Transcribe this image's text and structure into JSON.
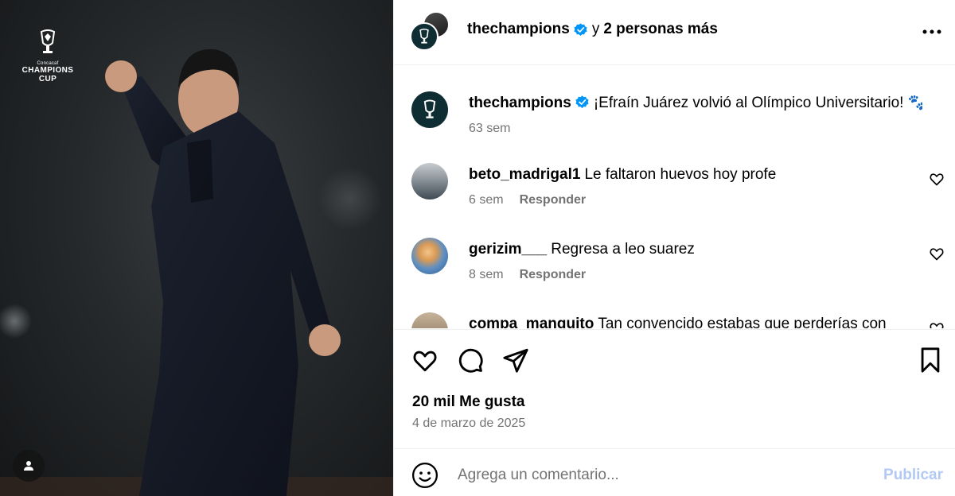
{
  "media": {
    "logo_small": "Concacaf",
    "logo_line1": "CHAMPIONS",
    "logo_line2": "CUP",
    "tag_icon": "user-icon"
  },
  "header": {
    "username": "thechampions",
    "verified": true,
    "connector": "y",
    "collaborators": "2 personas más",
    "more_icon": "more-options-icon"
  },
  "caption": {
    "username": "thechampions",
    "text": "¡Efraín Juárez volvió al Olímpico Universitario! 🐾",
    "time": "63 sem"
  },
  "comments": [
    {
      "username": "beto_madrigal1",
      "text": "Le faltaron huevos hoy profe",
      "time": "6 sem",
      "reply": "Responder"
    },
    {
      "username": "gerizim___",
      "text": "Regresa a leo suarez",
      "time": "8 sem",
      "reply": "Responder"
    },
    {
      "username": "compa_manguito",
      "text": "Tan convencido estabas que perderías con",
      "time": "",
      "reply": ""
    }
  ],
  "actions": {
    "likes": "20 mil Me gusta",
    "date": "4 de marzo de 2025"
  },
  "composer": {
    "placeholder": "Agrega un comentario...",
    "post_label": "Publicar"
  },
  "colors": {
    "muted_text": "#737373",
    "verified_blue": "#0095f6",
    "post_disabled": "#b2c9f5",
    "divider": "#efefef"
  }
}
